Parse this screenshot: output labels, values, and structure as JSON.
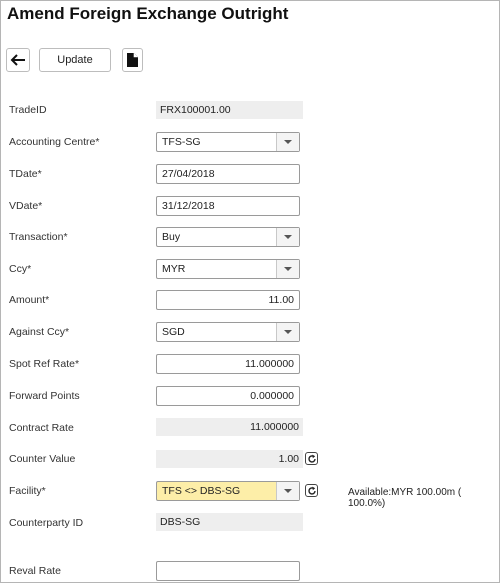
{
  "page": {
    "title": "Amend Foreign Exchange Outright"
  },
  "toolbar": {
    "update_label": "Update"
  },
  "form": {
    "trade_id": {
      "label": "TradeID",
      "value": "FRX100001.00"
    },
    "accounting_centre": {
      "label": "Accounting Centre*",
      "value": "TFS-SG"
    },
    "tdate": {
      "label": "TDate*",
      "value": "27/04/2018"
    },
    "vdate": {
      "label": "VDate*",
      "value": "31/12/2018"
    },
    "transaction": {
      "label": "Transaction*",
      "value": "Buy"
    },
    "ccy": {
      "label": "Ccy*",
      "value": "MYR"
    },
    "amount": {
      "label": "Amount*",
      "value": "11.00"
    },
    "against_ccy": {
      "label": "Against Ccy*",
      "value": "SGD"
    },
    "spot_ref_rate": {
      "label": "Spot Ref Rate*",
      "value": "11.000000"
    },
    "forward_points": {
      "label": "Forward Points",
      "value": "0.000000"
    },
    "contract_rate": {
      "label": "Contract Rate",
      "value": "11.000000"
    },
    "counter_value": {
      "label": "Counter Value",
      "value": "1.00"
    },
    "facility": {
      "label": "Facility*",
      "value": "TFS <> DBS-SG",
      "available": "Available:MYR 100.00m ( 100.0%)"
    },
    "counterparty_id": {
      "label": "Counterparty ID",
      "value": "DBS-SG"
    },
    "reval_rate": {
      "label": "Reval Rate",
      "value": ""
    }
  },
  "icons": {
    "back": "arrow-left-icon",
    "document": "document-icon",
    "refresh": "refresh-icon",
    "dropdown": "chevron-down-icon"
  }
}
